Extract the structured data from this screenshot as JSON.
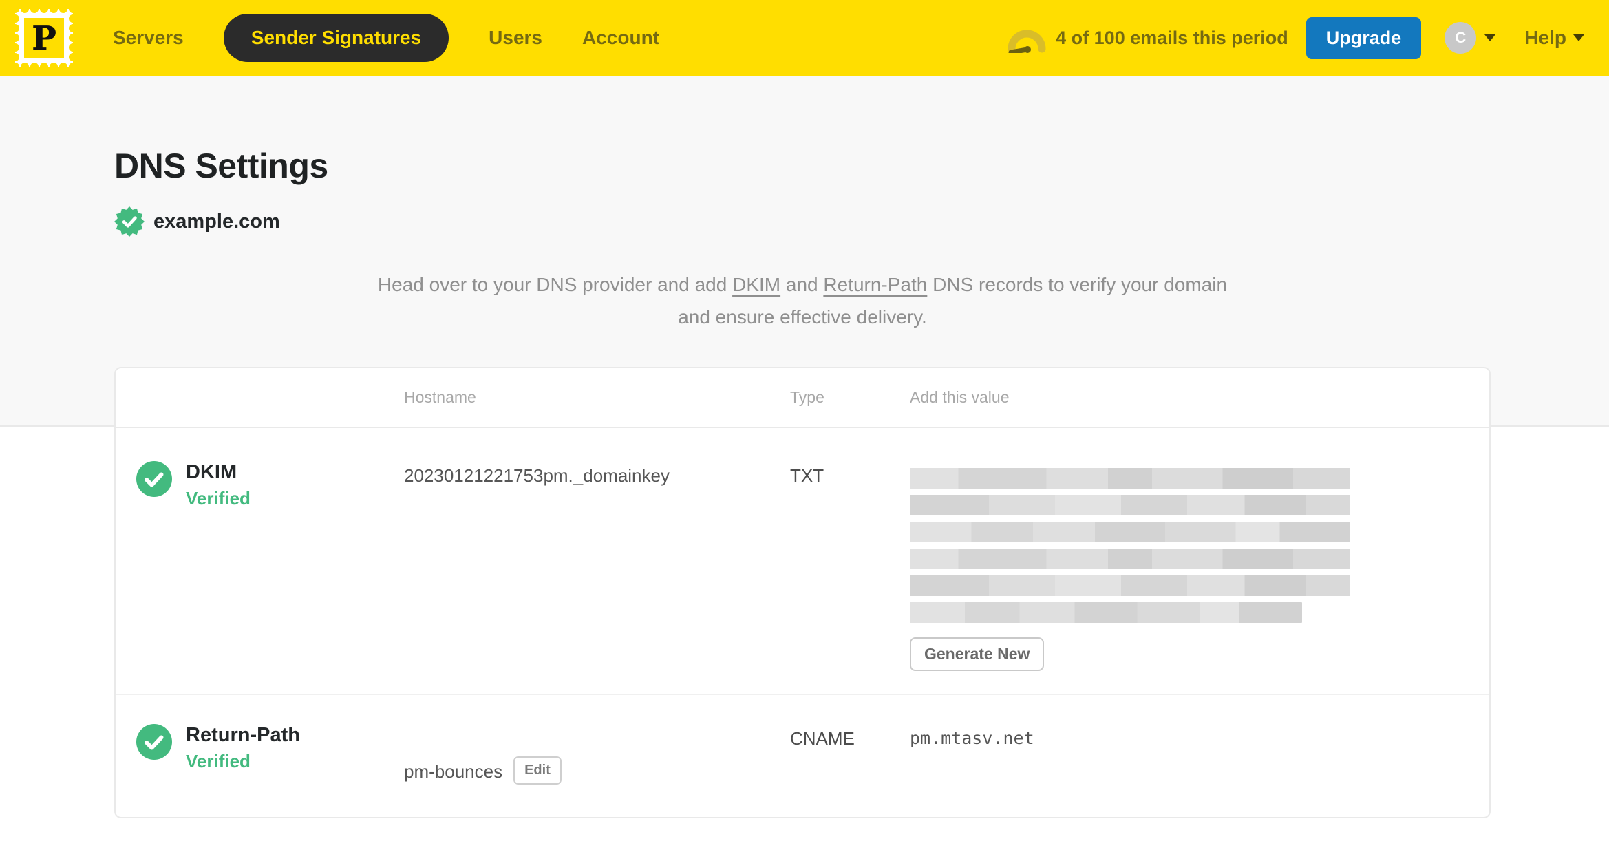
{
  "navbar": {
    "logo_letter": "P",
    "items": [
      {
        "label": "Servers",
        "active": false
      },
      {
        "label": "Sender Signatures",
        "active": true
      },
      {
        "label": "Users",
        "active": false
      },
      {
        "label": "Account",
        "active": false
      }
    ],
    "usage_text": "4 of 100 emails this period",
    "upgrade_label": "Upgrade",
    "avatar_letter": "C",
    "help_label": "Help"
  },
  "hero": {
    "title": "DNS Settings",
    "domain": "example.com",
    "description": {
      "part1": "Head over to your DNS provider and add ",
      "link1": "DKIM",
      "part2": " and ",
      "link2": "Return-Path",
      "part3": " DNS records to verify your domain and ensure effective delivery."
    }
  },
  "dns_table": {
    "headers": {
      "hostname": "Hostname",
      "type": "Type",
      "value": "Add this value"
    },
    "rows": [
      {
        "name": "DKIM",
        "status": "Verified",
        "hostname": "20230121221753pm._domainkey",
        "type": "TXT",
        "value_redacted": true,
        "action_label": "Generate New"
      },
      {
        "name": "Return-Path",
        "status": "Verified",
        "hostname": "pm-bounces",
        "edit_label": "Edit",
        "type": "CNAME",
        "value": "pm.mtasv.net"
      }
    ]
  },
  "colors": {
    "brand_yellow": "#FFDE00",
    "nav_text_olive": "#756A12",
    "active_pill_bg": "#2B2B2B",
    "upgrade_blue": "#1378BE",
    "verified_green": "#43BA7F",
    "heading_dark": "#1F2223",
    "muted_gray": "#8F8F8F"
  }
}
